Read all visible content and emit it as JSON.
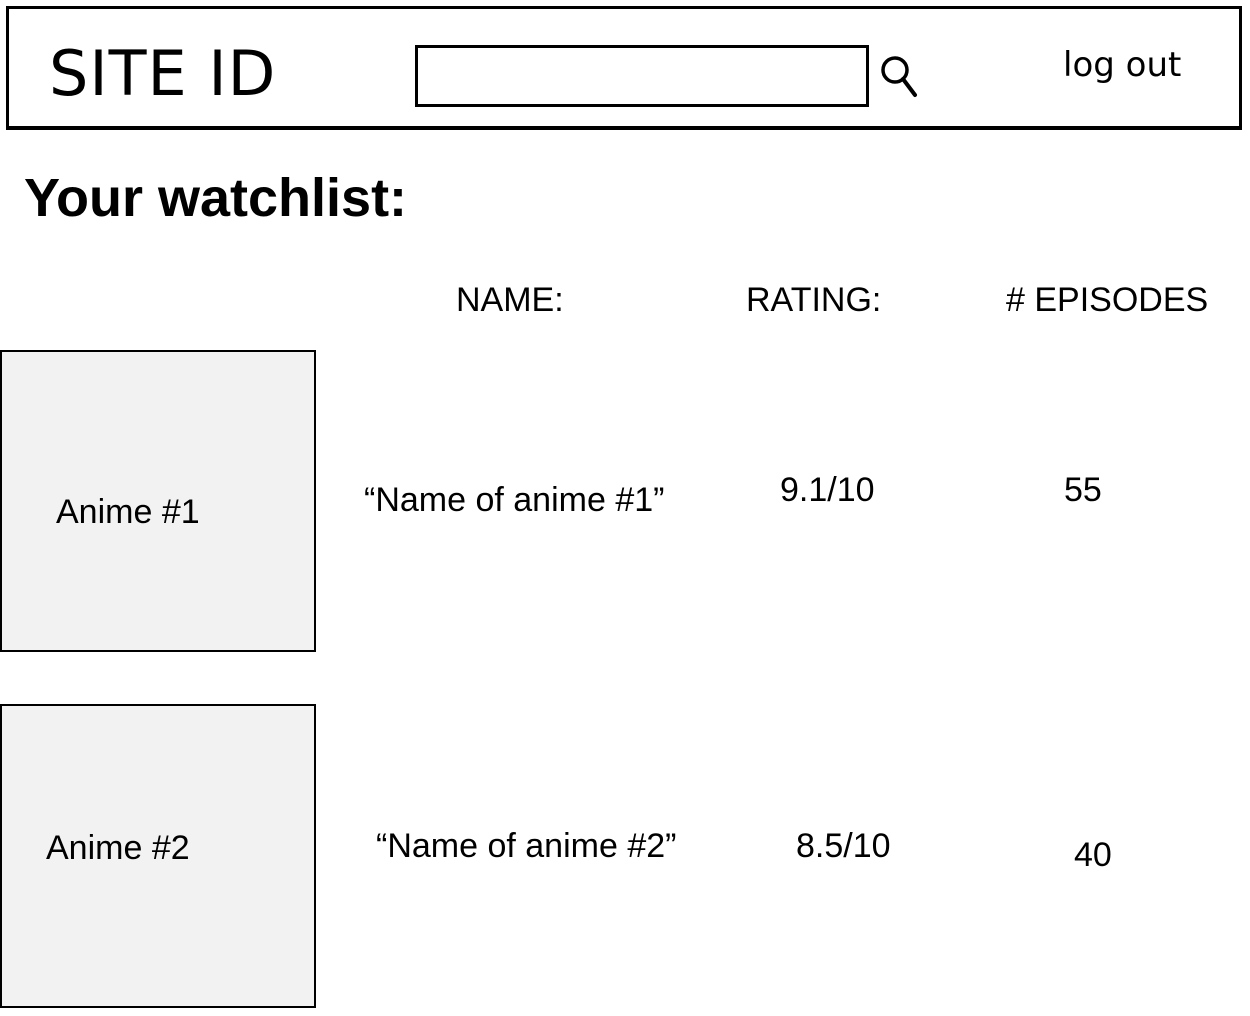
{
  "header": {
    "site_id": "SITE ID",
    "search": {
      "value": "",
      "placeholder": ""
    },
    "search_icon": "search-icon",
    "logout_label": "log out"
  },
  "page_title": "Your watchlist:",
  "table": {
    "columns": [
      "NAME:",
      "RATING:",
      "# EPISODES"
    ],
    "rows": [
      {
        "thumbnail_label": "Anime #1",
        "name": "“Name of anime #1”",
        "rating": "9.1/10",
        "episodes": "55"
      },
      {
        "thumbnail_label": "Anime #2",
        "name": "“Name of anime #2”",
        "rating": "8.5/10",
        "episodes": "40"
      }
    ]
  }
}
